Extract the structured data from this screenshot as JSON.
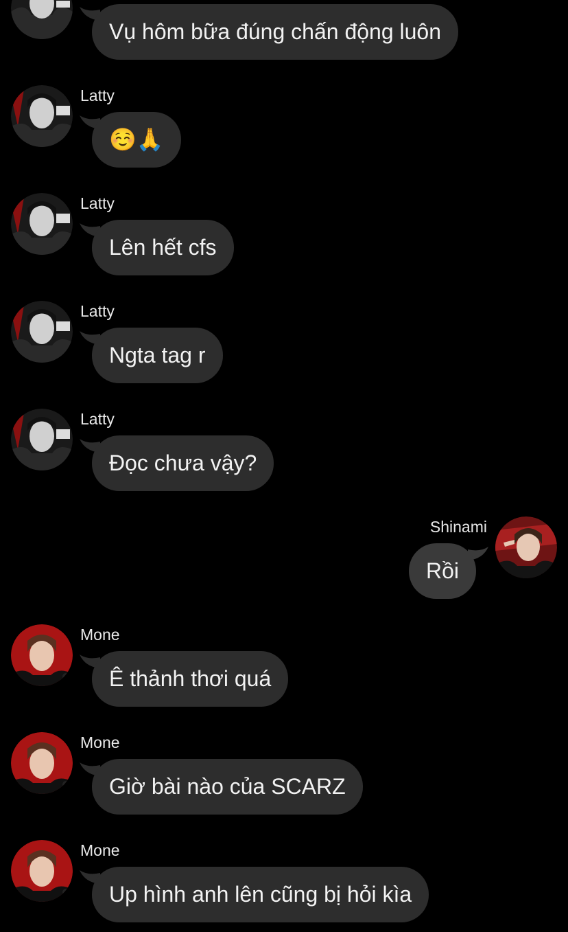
{
  "messages": [
    {
      "sender": "",
      "text": "Vụ hôm bữa đúng chấn động luôn",
      "direction": "in",
      "avatar": "latty-avatar"
    },
    {
      "sender": "Latty",
      "text": "☺️🙏",
      "direction": "in",
      "avatar": "latty-avatar"
    },
    {
      "sender": "Latty",
      "text": "Lên hết cfs",
      "direction": "in",
      "avatar": "latty-avatar"
    },
    {
      "sender": "Latty",
      "text": "Ngta tag r",
      "direction": "in",
      "avatar": "latty-avatar"
    },
    {
      "sender": "Latty",
      "text": "Đọc chưa vậy?",
      "direction": "in",
      "avatar": "latty-avatar"
    },
    {
      "sender": "Shinami",
      "text": "Rồi",
      "direction": "out",
      "avatar": "shinami-avatar"
    },
    {
      "sender": "Mone",
      "text": "Ê thảnh thơi quá",
      "direction": "in",
      "avatar": "mone-avatar"
    },
    {
      "sender": "Mone",
      "text": "Giờ bài nào của SCARZ",
      "direction": "in",
      "avatar": "mone-avatar"
    },
    {
      "sender": "Mone",
      "text": "Up hình anh lên cũng bị hỏi kìa",
      "direction": "in",
      "avatar": "mone-avatar"
    }
  ],
  "colors": {
    "background": "#000000",
    "bubble_incoming": "#2d2d2d",
    "bubble_outgoing": "#3a3a3a",
    "text": "#f2f2f2",
    "avatar_latty": "#3a3a3a",
    "avatar_mone": "#b01818",
    "avatar_shinami": "#8a1a1a"
  }
}
